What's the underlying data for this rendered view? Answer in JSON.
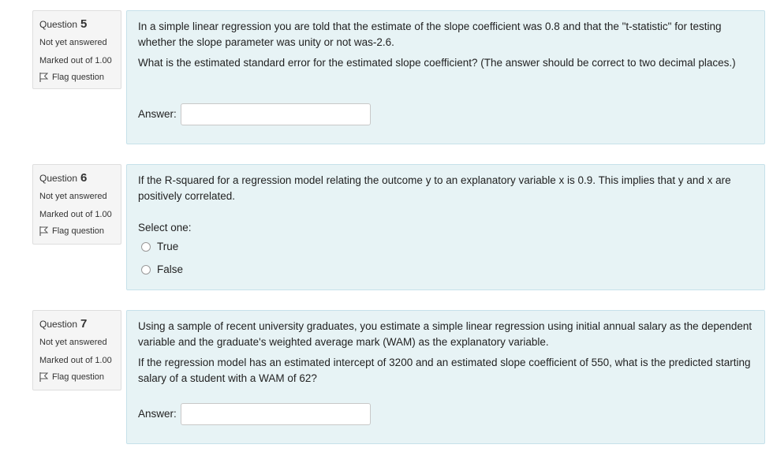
{
  "questions": [
    {
      "label": "Question",
      "number": "5",
      "status": "Not yet answered",
      "marks": "Marked out of 1.00",
      "flag": "Flag question",
      "text1": "In a simple linear regression you are told that the estimate of the slope coefficient was 0.8 and that the \"t-statistic\" for testing whether the slope parameter was unity or not was-2.6.",
      "text2": "What is the estimated standard error for the estimated slope coefficient? (The answer should be correct to two decimal places.)",
      "answer_label": "Answer:",
      "answer_value": ""
    },
    {
      "label": "Question",
      "number": "6",
      "status": "Not yet answered",
      "marks": "Marked out of 1.00",
      "flag": "Flag question",
      "text1": "If the R-squared for a regression model relating the outcome y to an explanatory variable x is 0.9. This implies that y and x are positively correlated.",
      "select_label": "Select one:",
      "options": [
        "True",
        "False"
      ]
    },
    {
      "label": "Question",
      "number": "7",
      "status": "Not yet answered",
      "marks": "Marked out of 1.00",
      "flag": "Flag question",
      "text1": "Using a sample of recent university graduates, you estimate a simple linear regression using initial annual salary as the dependent variable and the graduate's weighted average mark (WAM) as the explanatory variable.",
      "text2": "If the regression model has an estimated intercept of 3200 and an estimated slope coefficient of 550, what is the predicted starting salary of a student with a WAM of 62?",
      "answer_label": "Answer:",
      "answer_value": ""
    }
  ],
  "colors": {
    "content_bg": "#e7f3f5",
    "content_border": "#c6e1ea",
    "info_bg": "#f5f5f5"
  },
  "icons": {
    "flag": "flag-icon"
  }
}
